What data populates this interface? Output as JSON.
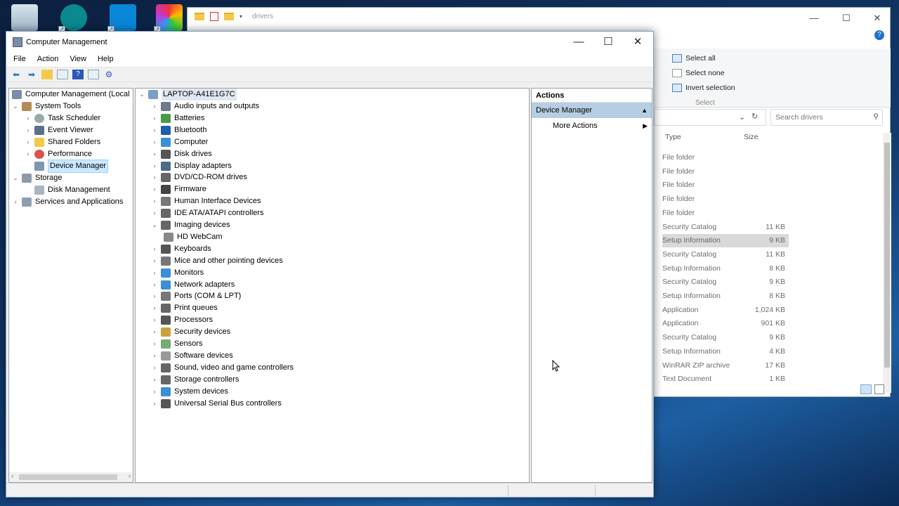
{
  "desktop": {
    "icons": [
      "recycle-bin-icon",
      "arduino-icon",
      "app-icon",
      "color-app-icon"
    ]
  },
  "explorer": {
    "address_tab": "drivers",
    "ribbon": {
      "select_all": "Select all",
      "select_none": "Select none",
      "invert_selection": "Invert selection",
      "group_label": "Select"
    },
    "search_placeholder": "Search drivers",
    "columns": {
      "type": "Type",
      "size": "Size"
    },
    "rows": [
      {
        "type": "File folder",
        "size": ""
      },
      {
        "type": "File folder",
        "size": ""
      },
      {
        "type": "File folder",
        "size": ""
      },
      {
        "type": "File folder",
        "size": ""
      },
      {
        "type": "File folder",
        "size": ""
      },
      {
        "type": "Security Catalog",
        "size": "11 KB"
      },
      {
        "type": "Setup Information",
        "size": "9 KB"
      },
      {
        "type": "Security Catalog",
        "size": "11 KB"
      },
      {
        "type": "Setup Information",
        "size": "8 KB"
      },
      {
        "type": "Security Catalog",
        "size": "9 KB"
      },
      {
        "type": "Setup Information",
        "size": "8 KB"
      },
      {
        "type": "Application",
        "size": "1,024 KB"
      },
      {
        "type": "Application",
        "size": "901 KB"
      },
      {
        "type": "Security Catalog",
        "size": "9 KB"
      },
      {
        "type": "Setup Information",
        "size": "4 KB"
      },
      {
        "type": "WinRAR ZIP archive",
        "size": "17 KB"
      },
      {
        "type": "Text Document",
        "size": "1 KB"
      }
    ]
  },
  "cm": {
    "title": "Computer Management",
    "menu": [
      "File",
      "Action",
      "View",
      "Help"
    ],
    "tree": {
      "root": "Computer Management (Local",
      "system_tools": "System Tools",
      "task_scheduler": "Task Scheduler",
      "event_viewer": "Event Viewer",
      "shared_folders": "Shared Folders",
      "performance": "Performance",
      "device_manager": "Device Manager",
      "storage": "Storage",
      "disk_management": "Disk Management",
      "services": "Services and Applications"
    },
    "devices": {
      "computer_name": "LAPTOP-A41E1G7C",
      "items": [
        "Audio inputs and outputs",
        "Batteries",
        "Bluetooth",
        "Computer",
        "Disk drives",
        "Display adapters",
        "DVD/CD-ROM drives",
        "Firmware",
        "Human Interface Devices",
        "IDE ATA/ATAPI controllers",
        "Imaging devices",
        "HD WebCam",
        "Keyboards",
        "Mice and other pointing devices",
        "Monitors",
        "Network adapters",
        "Ports (COM & LPT)",
        "Print queues",
        "Processors",
        "Security devices",
        "Sensors",
        "Software devices",
        "Sound, video and game controllers",
        "Storage controllers",
        "System devices",
        "Universal Serial Bus controllers"
      ]
    },
    "actions": {
      "header": "Actions",
      "section": "Device Manager",
      "more": "More Actions"
    }
  }
}
